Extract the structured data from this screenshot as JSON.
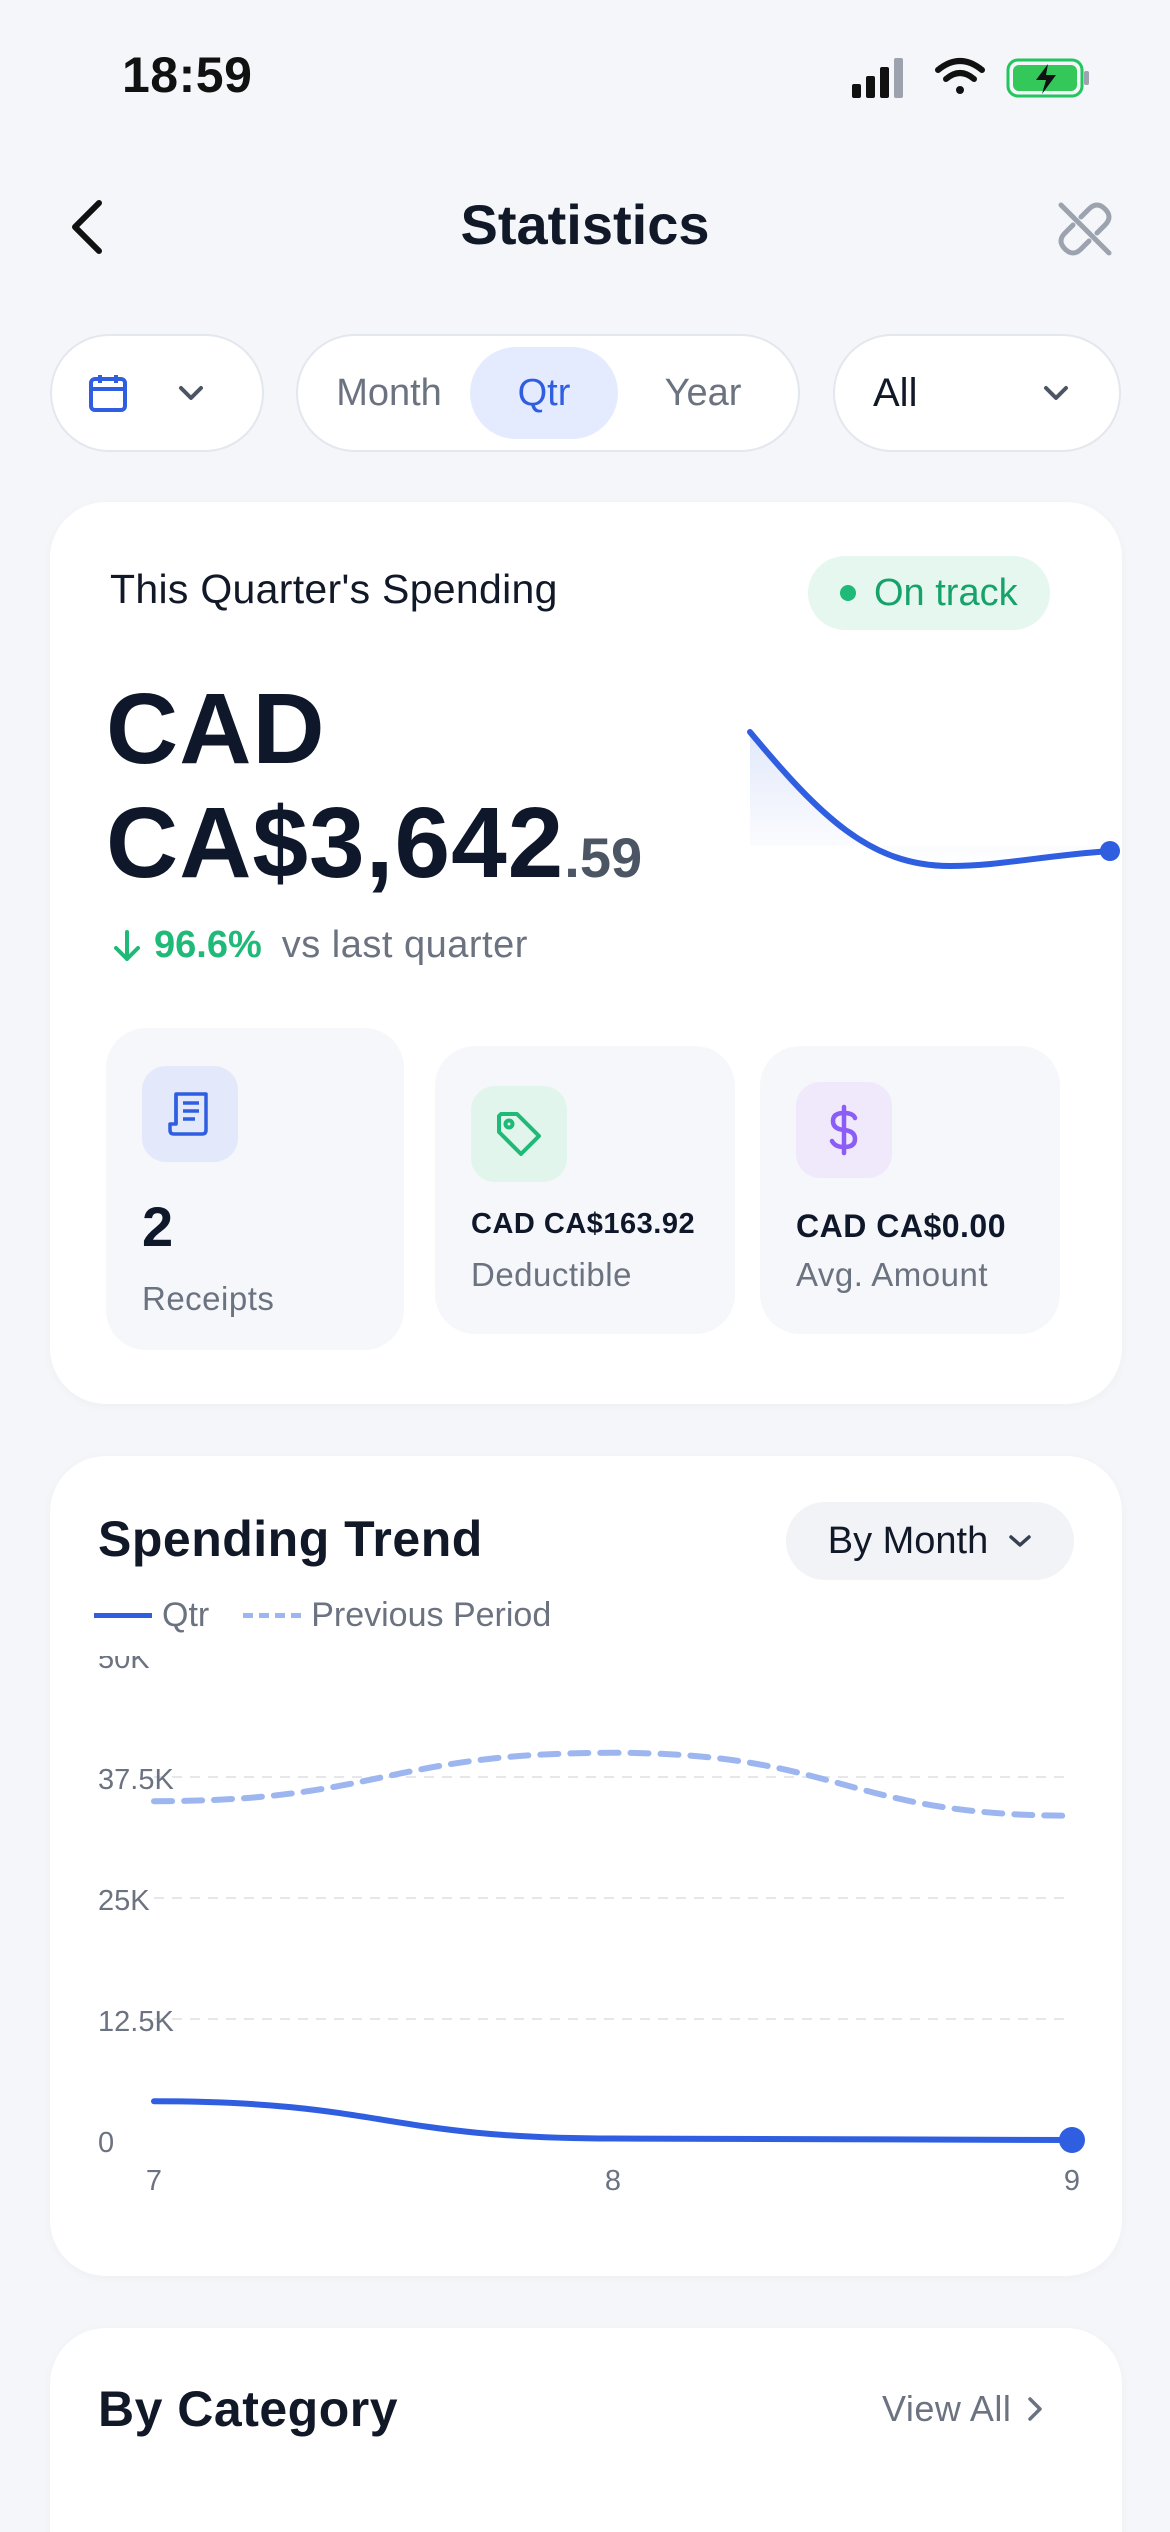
{
  "status_bar": {
    "time": "18:59"
  },
  "nav": {
    "title": "Statistics"
  },
  "filters": {
    "period_options": [
      "Month",
      "Qtr",
      "Year"
    ],
    "period_selected": "Qtr",
    "scope_value": "All"
  },
  "summary": {
    "title": "This Quarter's Spending",
    "badge": "On track",
    "amount_currency": "CAD",
    "amount_main": "CA$3,642",
    "amount_cents": ".59",
    "change_pct": "96.6%",
    "change_text": "vs last quarter",
    "stats": [
      {
        "value": "2",
        "label": "Receipts",
        "icon": "receipt-icon"
      },
      {
        "value": "CAD CA$163.92",
        "label": "Deductible",
        "icon": "tag-icon"
      },
      {
        "value": "CAD CA$0.00",
        "label": "Avg. Amount",
        "icon": "dollar-icon"
      }
    ],
    "colors": {
      "positive": "#1fb978",
      "accent": "#2f5fe0"
    }
  },
  "trend": {
    "title": "Spending Trend",
    "group_by": "By Month",
    "legend": {
      "current": "Qtr",
      "previous": "Previous Period"
    }
  },
  "chart_data": {
    "type": "line",
    "x": [
      "7",
      "8",
      "9"
    ],
    "ylim": [
      0,
      50000
    ],
    "y_ticks": [
      "0",
      "12.5K",
      "25K",
      "37.5K",
      "50K"
    ],
    "y_tick_values": [
      0,
      12500,
      25000,
      37500,
      50000
    ],
    "grid": true,
    "legend_position": "top-left",
    "series": [
      {
        "name": "Qtr",
        "values": [
          4000,
          150,
          0
        ],
        "style": "solid",
        "color": "#2f5fe0"
      },
      {
        "name": "Previous Period",
        "values": [
          35000,
          40000,
          33500
        ],
        "style": "dashed",
        "color": "#9db6f0"
      }
    ]
  },
  "category": {
    "title": "By Category",
    "view_all": "View All"
  }
}
